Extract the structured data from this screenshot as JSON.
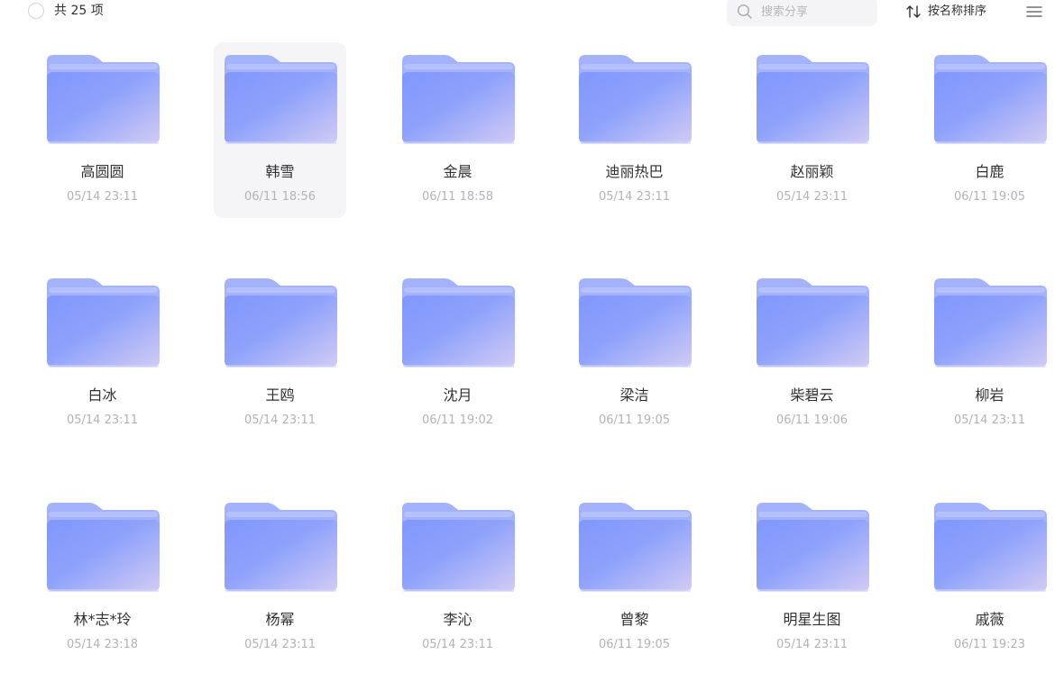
{
  "header": {
    "count_label": "共 25 项",
    "search_placeholder": "搜索分享",
    "search_value": "",
    "sort_label": "按名称排序"
  },
  "colors": {
    "folder_back": "#a3b2fb",
    "folder_front_start": "#8097fc",
    "folder_front_end": "#d2cbf4",
    "selected_bg": "#f5f5f7"
  },
  "folders": [
    {
      "name": "高圆圆",
      "date": "05/14 23:11",
      "selected": false
    },
    {
      "name": "韩雪",
      "date": "06/11 18:56",
      "selected": true
    },
    {
      "name": "金晨",
      "date": "06/11 18:58",
      "selected": false
    },
    {
      "name": "迪丽热巴",
      "date": "05/14 23:11",
      "selected": false
    },
    {
      "name": "赵丽颖",
      "date": "05/14 23:11",
      "selected": false
    },
    {
      "name": "白鹿",
      "date": "06/11 19:05",
      "selected": false
    },
    {
      "name": "白冰",
      "date": "05/14 23:11",
      "selected": false
    },
    {
      "name": "王鸥",
      "date": "05/14 23:11",
      "selected": false
    },
    {
      "name": "沈月",
      "date": "06/11 19:02",
      "selected": false
    },
    {
      "name": "梁洁",
      "date": "06/11 19:05",
      "selected": false
    },
    {
      "name": "柴碧云",
      "date": "06/11 19:06",
      "selected": false
    },
    {
      "name": "柳岩",
      "date": "05/14 23:11",
      "selected": false
    },
    {
      "name": "林*志*玲",
      "date": "05/14 23:18",
      "selected": false
    },
    {
      "name": "杨幂",
      "date": "05/14 23:11",
      "selected": false
    },
    {
      "name": "李沁",
      "date": "05/14 23:11",
      "selected": false
    },
    {
      "name": "曾黎",
      "date": "06/11 19:05",
      "selected": false
    },
    {
      "name": "明星生图",
      "date": "05/14 23:11",
      "selected": false
    },
    {
      "name": "戚薇",
      "date": "06/11 19:23",
      "selected": false
    }
  ]
}
